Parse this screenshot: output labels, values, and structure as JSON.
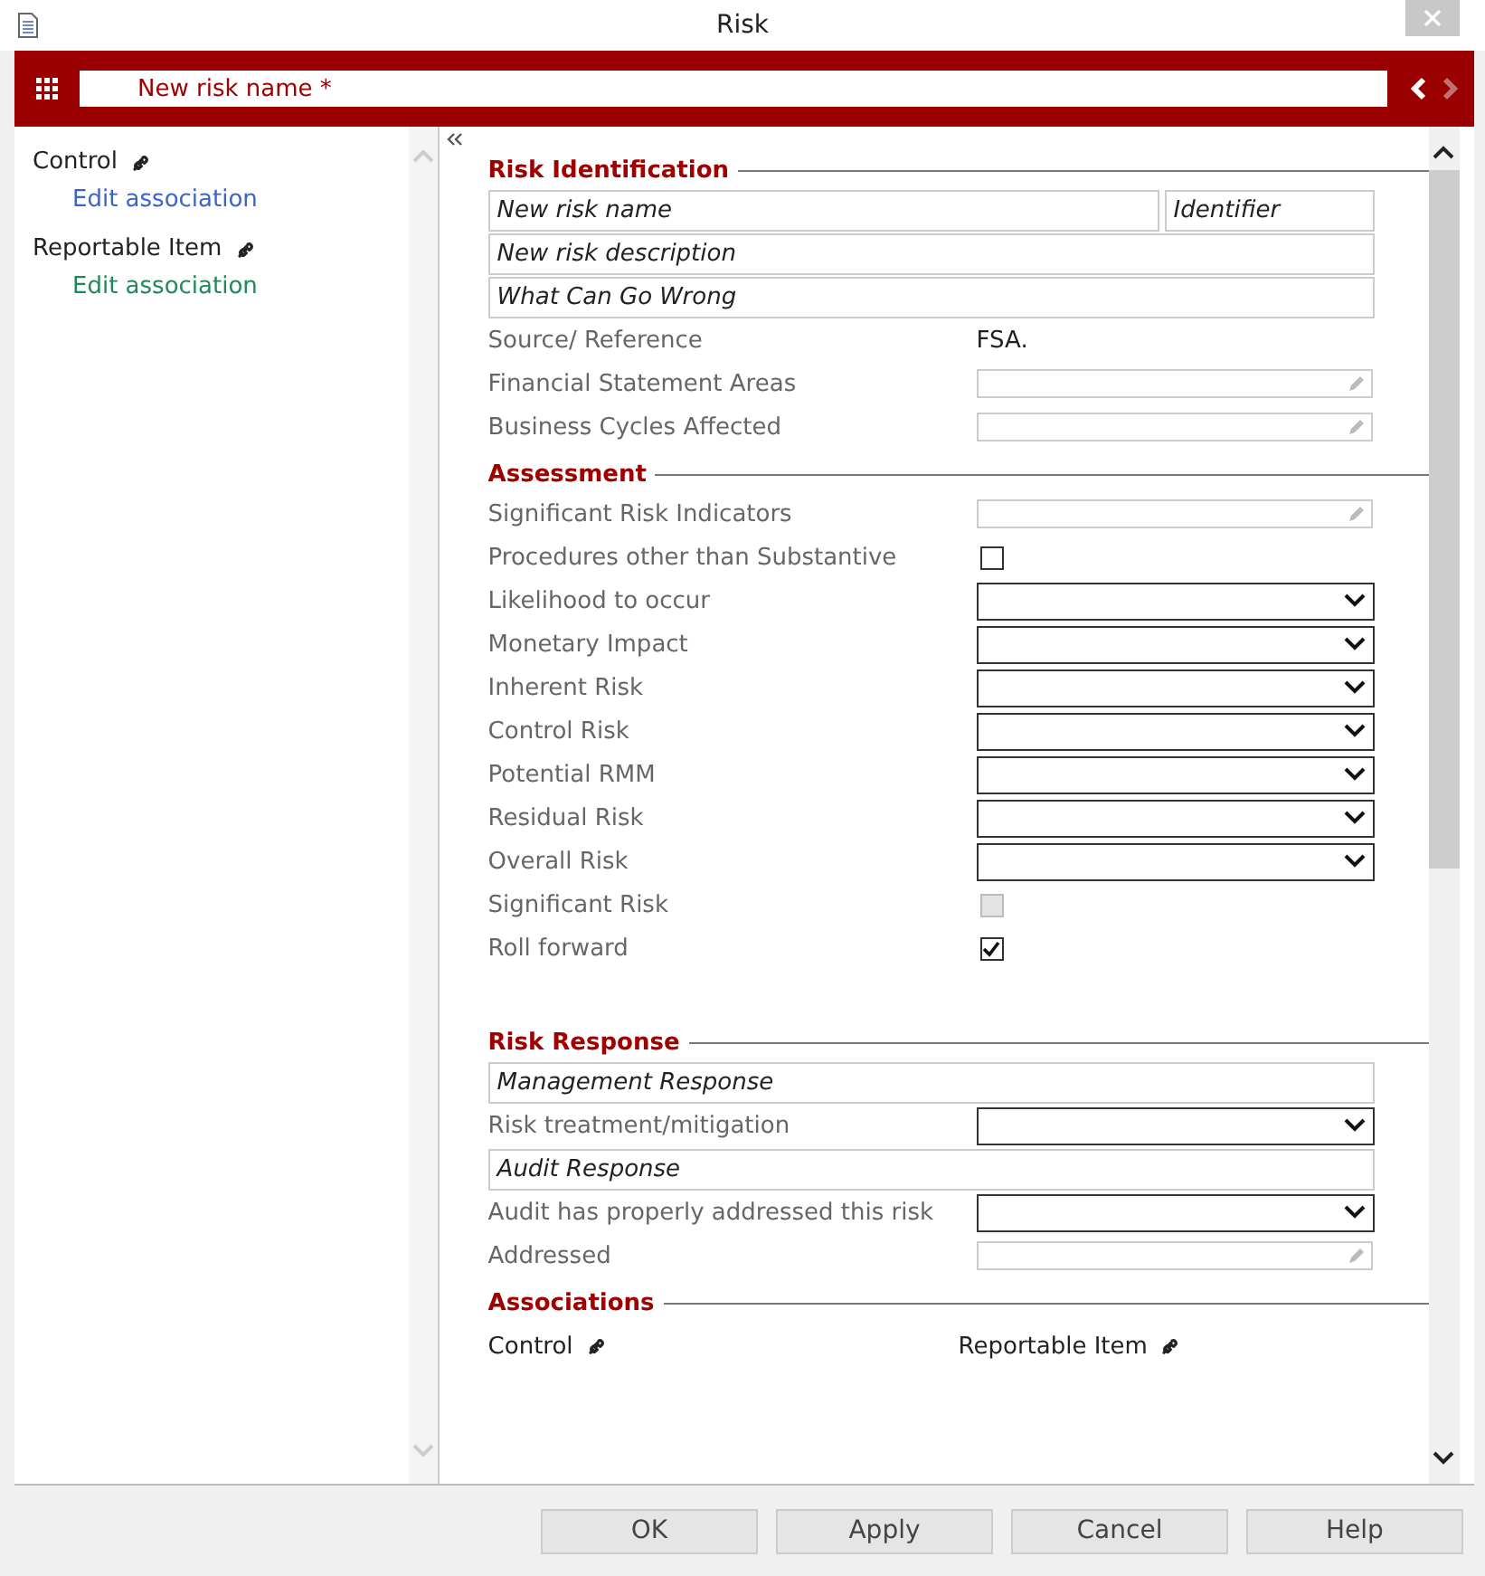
{
  "window": {
    "title": "Risk"
  },
  "header": {
    "name": "New risk name *"
  },
  "sidebar": {
    "items": [
      {
        "label": "Control",
        "link": "Edit association",
        "color": "#3c64c8"
      },
      {
        "label": "Reportable Item",
        "link": "Edit association",
        "color": "#1e8a5a"
      }
    ]
  },
  "sections": [
    {
      "title": "Risk Identification",
      "rows": [
        {
          "kind": "fields",
          "fields": [
            {
              "placeholder": "New risk name"
            },
            {
              "placeholder": "Identifier"
            }
          ]
        },
        {
          "kind": "fields",
          "fields": [
            {
              "placeholder": "New risk description"
            }
          ]
        },
        {
          "kind": "fields",
          "fields": [
            {
              "placeholder": "What Can Go Wrong"
            }
          ]
        },
        {
          "kind": "value",
          "label": "Source/ Reference",
          "value": "FSA."
        },
        {
          "kind": "picker",
          "label": "Financial Statement Areas"
        },
        {
          "kind": "picker",
          "label": "Business Cycles Affected"
        }
      ]
    },
    {
      "title": "Assessment",
      "rows": [
        {
          "kind": "picker",
          "label": "Significant Risk Indicators"
        },
        {
          "kind": "checkbox",
          "label": "Procedures other than Substantive",
          "checked": false,
          "disabled": false
        },
        {
          "kind": "dropdown",
          "label": "Likelihood to occur"
        },
        {
          "kind": "dropdown",
          "label": "Monetary Impact"
        },
        {
          "kind": "dropdown",
          "label": "Inherent Risk"
        },
        {
          "kind": "dropdown",
          "label": "Control Risk"
        },
        {
          "kind": "dropdown",
          "label": "Potential RMM"
        },
        {
          "kind": "dropdown",
          "label": "Residual Risk"
        },
        {
          "kind": "dropdown",
          "label": "Overall Risk"
        },
        {
          "kind": "checkbox",
          "label": "Significant Risk",
          "checked": false,
          "disabled": true
        },
        {
          "kind": "checkbox",
          "label": "Roll forward",
          "checked": true,
          "disabled": false
        }
      ]
    },
    {
      "title": "Risk Response",
      "rows": [
        {
          "kind": "fields",
          "fields": [
            {
              "placeholder": "Management Response"
            }
          ]
        },
        {
          "kind": "dropdown",
          "label": "Risk treatment/mitigation"
        },
        {
          "kind": "fields",
          "fields": [
            {
              "placeholder": "Audit Response"
            }
          ]
        },
        {
          "kind": "dropdown",
          "label": "Audit has properly addressed this risk"
        },
        {
          "kind": "picker",
          "label": "Addressed"
        }
      ]
    },
    {
      "title": "Associations",
      "rows": [
        {
          "kind": "links",
          "links": [
            "Control",
            "Reportable Item"
          ]
        }
      ]
    }
  ],
  "buttons": [
    "OK",
    "Apply",
    "Cancel",
    "Help"
  ]
}
